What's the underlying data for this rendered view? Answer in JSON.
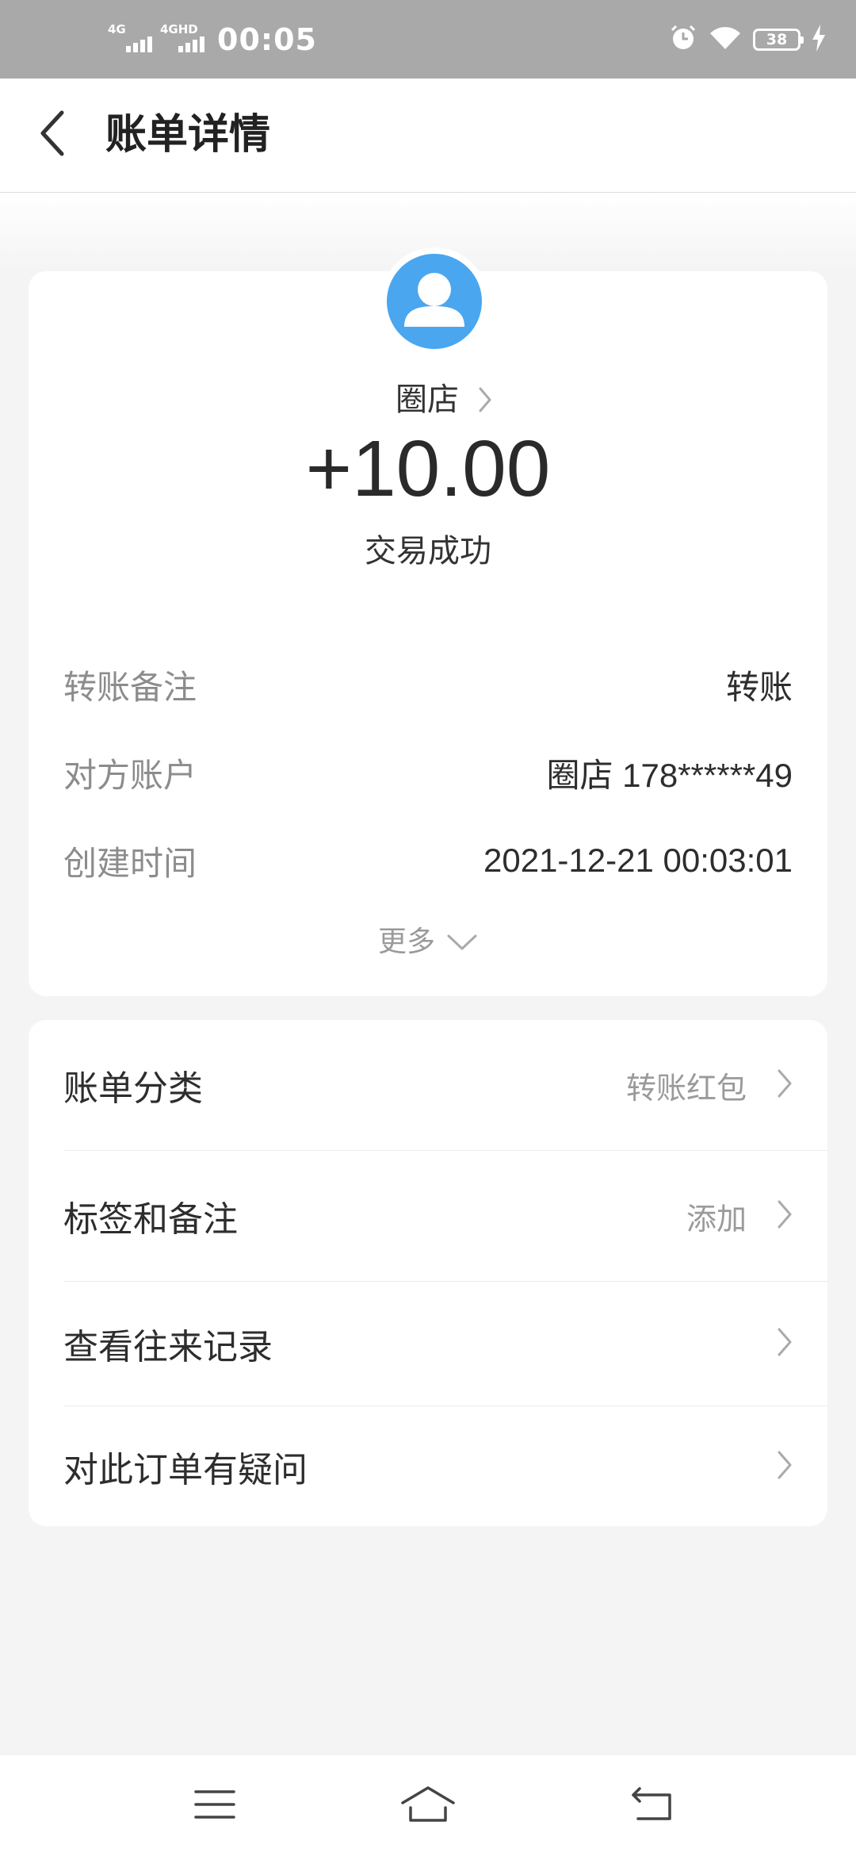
{
  "status_bar": {
    "network_1": "4G",
    "network_2": "4GHD",
    "time": "00:05",
    "battery": "38",
    "icons": [
      "alarm-icon",
      "wifi-icon",
      "battery-icon",
      "charging-icon"
    ]
  },
  "header": {
    "title": "账单详情",
    "back_icon": "chevron-left-icon"
  },
  "transaction": {
    "payee": "圈店",
    "amount": "+10.00",
    "status": "交易成功",
    "avatar_color": "#4aa6ef",
    "details": [
      {
        "label": "转账备注",
        "value": "转账"
      },
      {
        "label": "对方账户",
        "value": "圈店 178******49"
      },
      {
        "label": "创建时间",
        "value": "2021-12-21 00:03:01"
      }
    ],
    "more_label": "更多"
  },
  "menu": {
    "items": [
      {
        "label": "账单分类",
        "value": "转账红包"
      },
      {
        "label": "标签和备注",
        "value": "添加"
      },
      {
        "label": "查看往来记录",
        "value": ""
      },
      {
        "label": "对此订单有疑问",
        "value": ""
      }
    ]
  },
  "nav_bar": {
    "icons": [
      "menu-icon",
      "home-icon",
      "back-icon"
    ]
  }
}
